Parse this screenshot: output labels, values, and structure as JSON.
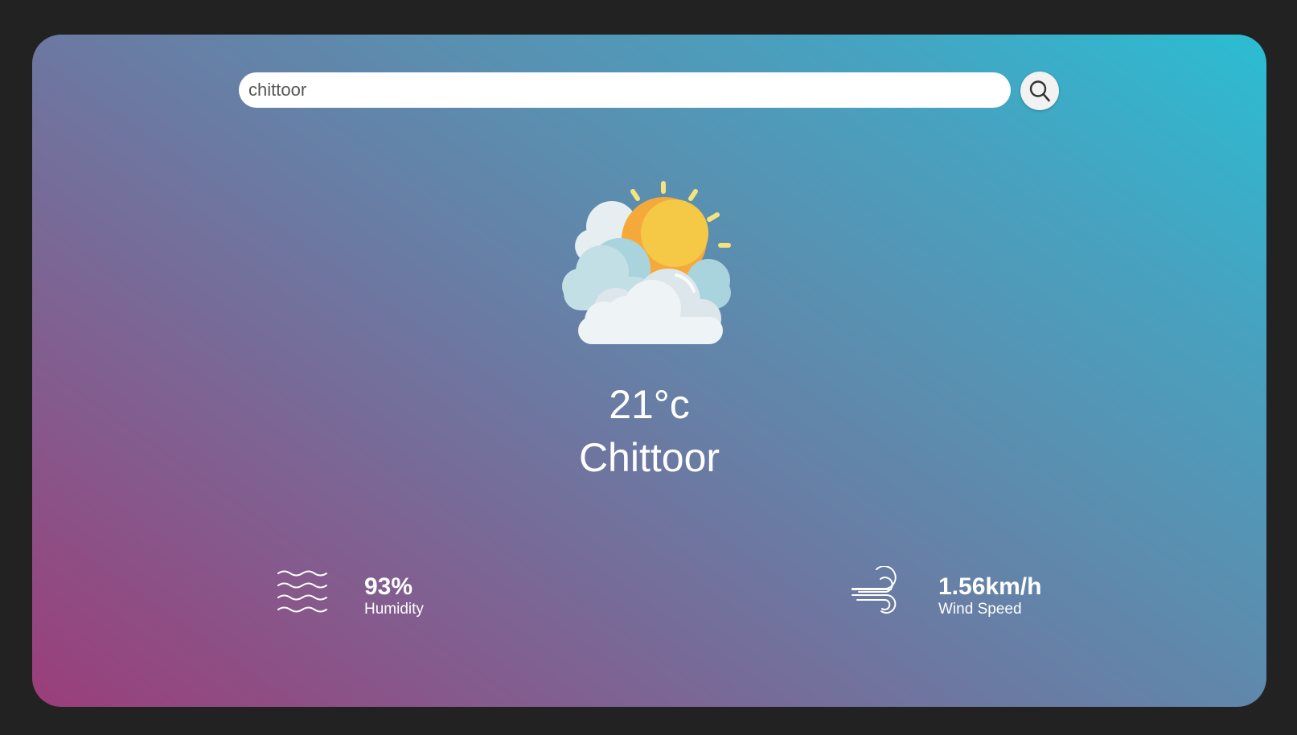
{
  "search": {
    "value": "chittoor",
    "button_icon": "search-icon"
  },
  "weather": {
    "condition_icon": "partly-cloudy-sun-icon",
    "temperature": "21°c",
    "city": "Chittoor"
  },
  "humidity": {
    "icon": "humidity-waves-icon",
    "value": "93%",
    "label": "Humidity"
  },
  "wind": {
    "icon": "wind-icon",
    "value": "1.56km/h",
    "label": "Wind Speed"
  },
  "colors": {
    "page_background": "#222222",
    "gradient_start": "#9a3e7a",
    "gradient_end": "#2bbdd3",
    "text": "#ffffff"
  }
}
